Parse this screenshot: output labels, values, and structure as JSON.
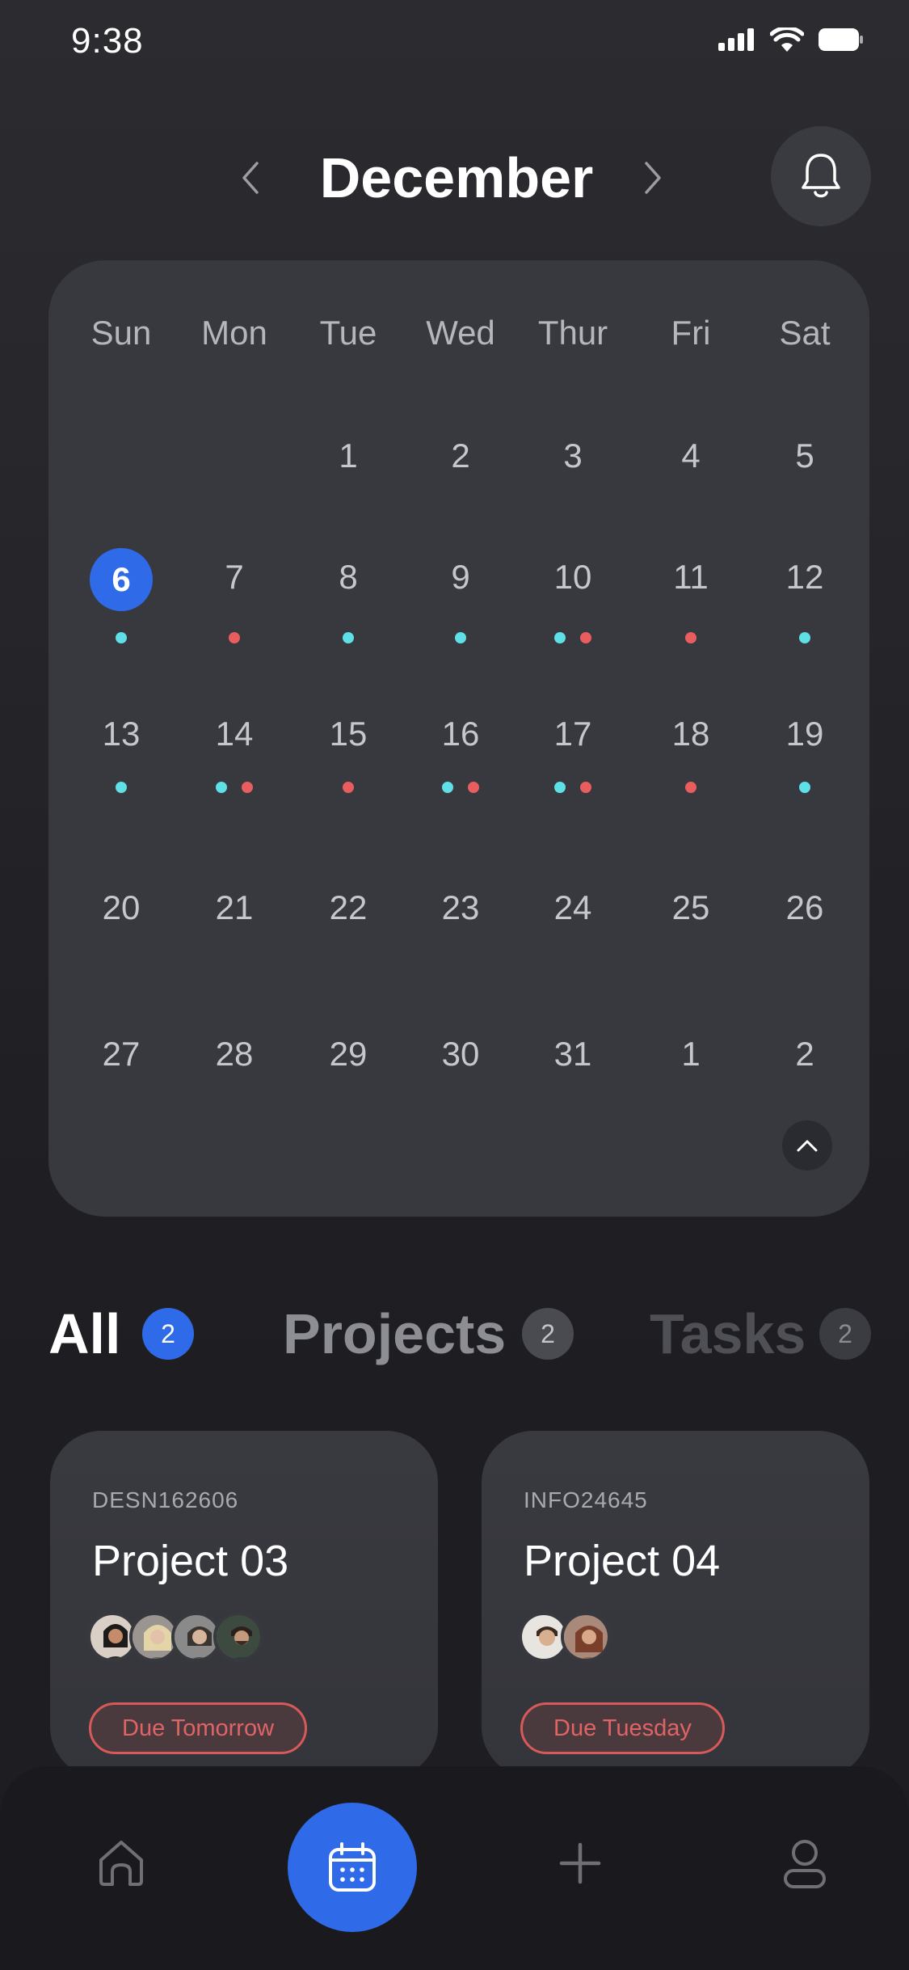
{
  "status_bar": {
    "time": "9:38"
  },
  "header": {
    "month": "December"
  },
  "calendar": {
    "weekdays": [
      "Sun",
      "Mon",
      "Tue",
      "Wed",
      "Thur",
      "Fri",
      "Sat"
    ],
    "weeks": [
      [
        "",
        "",
        "1",
        "2",
        "3",
        "4",
        "5"
      ],
      [
        "6",
        "7",
        "8",
        "9",
        "10",
        "11",
        "12"
      ],
      [
        "13",
        "14",
        "15",
        "16",
        "17",
        "18",
        "19"
      ],
      [
        "20",
        "21",
        "22",
        "23",
        "24",
        "25",
        "26"
      ],
      [
        "27",
        "28",
        "29",
        "30",
        "31",
        "1",
        "2"
      ]
    ],
    "today": "6",
    "event_dots": {
      "6": [
        "cyan"
      ],
      "7": [
        "red"
      ],
      "8": [
        "cyan"
      ],
      "9": [
        "cyan"
      ],
      "10": [
        "cyan",
        "red"
      ],
      "11": [
        "red"
      ],
      "12": [
        "cyan"
      ],
      "13": [
        "cyan"
      ],
      "14": [
        "cyan",
        "red"
      ],
      "15": [
        "red"
      ],
      "16": [
        "cyan",
        "red"
      ],
      "17": [
        "cyan",
        "red"
      ],
      "18": [
        "red"
      ],
      "19": [
        "cyan"
      ]
    }
  },
  "tabs": {
    "all": {
      "label": "All",
      "count": "2"
    },
    "projects": {
      "label": "Projects",
      "count": "2"
    },
    "tasks": {
      "label": "Tasks",
      "count": "2"
    }
  },
  "projects": [
    {
      "code": "DESN162606",
      "title": "Project 03",
      "due": "Due Tomorrow",
      "avatar_count": 4
    },
    {
      "code": "INFO24645",
      "title": "Project 04",
      "due": "Due Tuesday",
      "avatar_count": 2
    }
  ],
  "colors": {
    "accent": "#2f6be8",
    "dot_cyan": "#5ee0e6",
    "dot_red": "#e85d5d",
    "due_red": "#e06466"
  },
  "icons": {
    "prev": "chevron-left-icon",
    "next": "chevron-right-icon",
    "bell": "bell-icon",
    "collapse": "chevron-up-icon",
    "nav": [
      "home-icon",
      "calendar-icon",
      "plus-icon",
      "user-icon"
    ]
  }
}
